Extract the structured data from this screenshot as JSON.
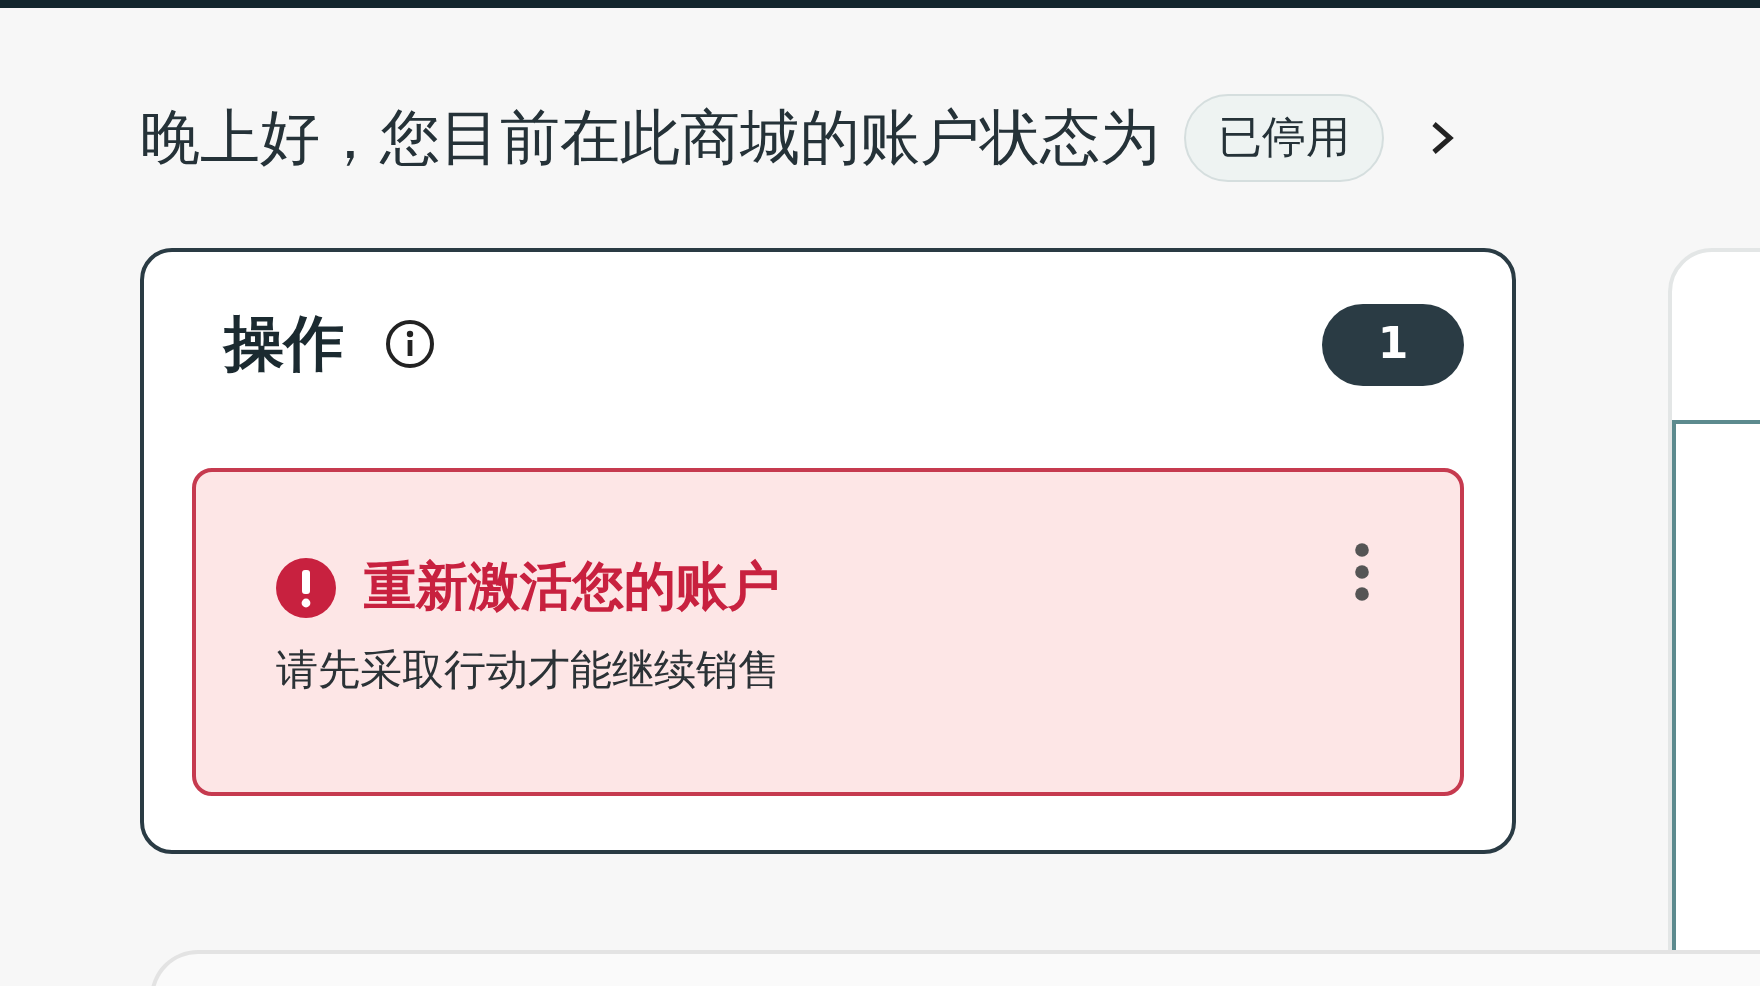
{
  "greeting": {
    "text": "晚上好，您目前在此商城的账户状态为",
    "status_badge": "已停用"
  },
  "actions_card": {
    "title": "操作",
    "count": "1",
    "alerts": [
      {
        "kind": "error",
        "title": "重新激活您的账户",
        "message": "请先采取行动才能继续销售"
      }
    ]
  }
}
